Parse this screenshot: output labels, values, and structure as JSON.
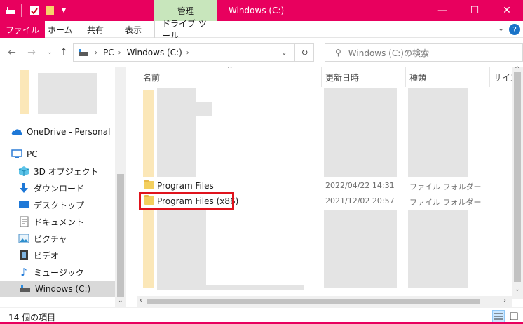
{
  "window": {
    "title": "Windows (C:)",
    "context_tab": "管理",
    "controls": {
      "minimize": "—",
      "maximize": "☐",
      "close": "✕"
    }
  },
  "ribbon": {
    "tabs": [
      {
        "label": "ファイル",
        "active": true
      },
      {
        "label": "ホーム"
      },
      {
        "label": "共有"
      },
      {
        "label": "表示"
      },
      {
        "label": "ドライブ ツール"
      }
    ],
    "expand_icon": "chevron-down-icon",
    "help_icon": "help-icon"
  },
  "address": {
    "crumbs": [
      "PC",
      "Windows (C:)"
    ],
    "search_placeholder": "Windows (C:)の検索"
  },
  "nav_pane": {
    "items": [
      {
        "label": "OneDrive - Personal",
        "icon": "cloud-icon"
      },
      {
        "label": "PC",
        "icon": "pc-icon"
      },
      {
        "label": "3D オブジェクト",
        "icon": "cube-icon"
      },
      {
        "label": "ダウンロード",
        "icon": "download-icon"
      },
      {
        "label": "デスクトップ",
        "icon": "desktop-icon"
      },
      {
        "label": "ドキュメント",
        "icon": "document-icon"
      },
      {
        "label": "ピクチャ",
        "icon": "picture-icon"
      },
      {
        "label": "ビデオ",
        "icon": "video-icon"
      },
      {
        "label": "ミュージック",
        "icon": "music-icon"
      },
      {
        "label": "Windows (C:)",
        "icon": "drive-icon",
        "selected": true
      }
    ]
  },
  "file_list": {
    "columns": [
      "名前",
      "更新日時",
      "種類",
      "サイズ"
    ],
    "visible_rows": [
      {
        "name": "Program Files",
        "modified": "2022/04/22 14:31",
        "type": "ファイル フォルダー"
      },
      {
        "name": "Program Files (x86)",
        "modified": "2021/12/02 20:57",
        "type": "ファイル フォルダー",
        "highlighted": true
      }
    ]
  },
  "status": {
    "item_count": "14 個の項目"
  },
  "colors": {
    "accent": "#e8005e",
    "context_tab": "#c8e6bc",
    "highlight_box": "#e0131c"
  }
}
